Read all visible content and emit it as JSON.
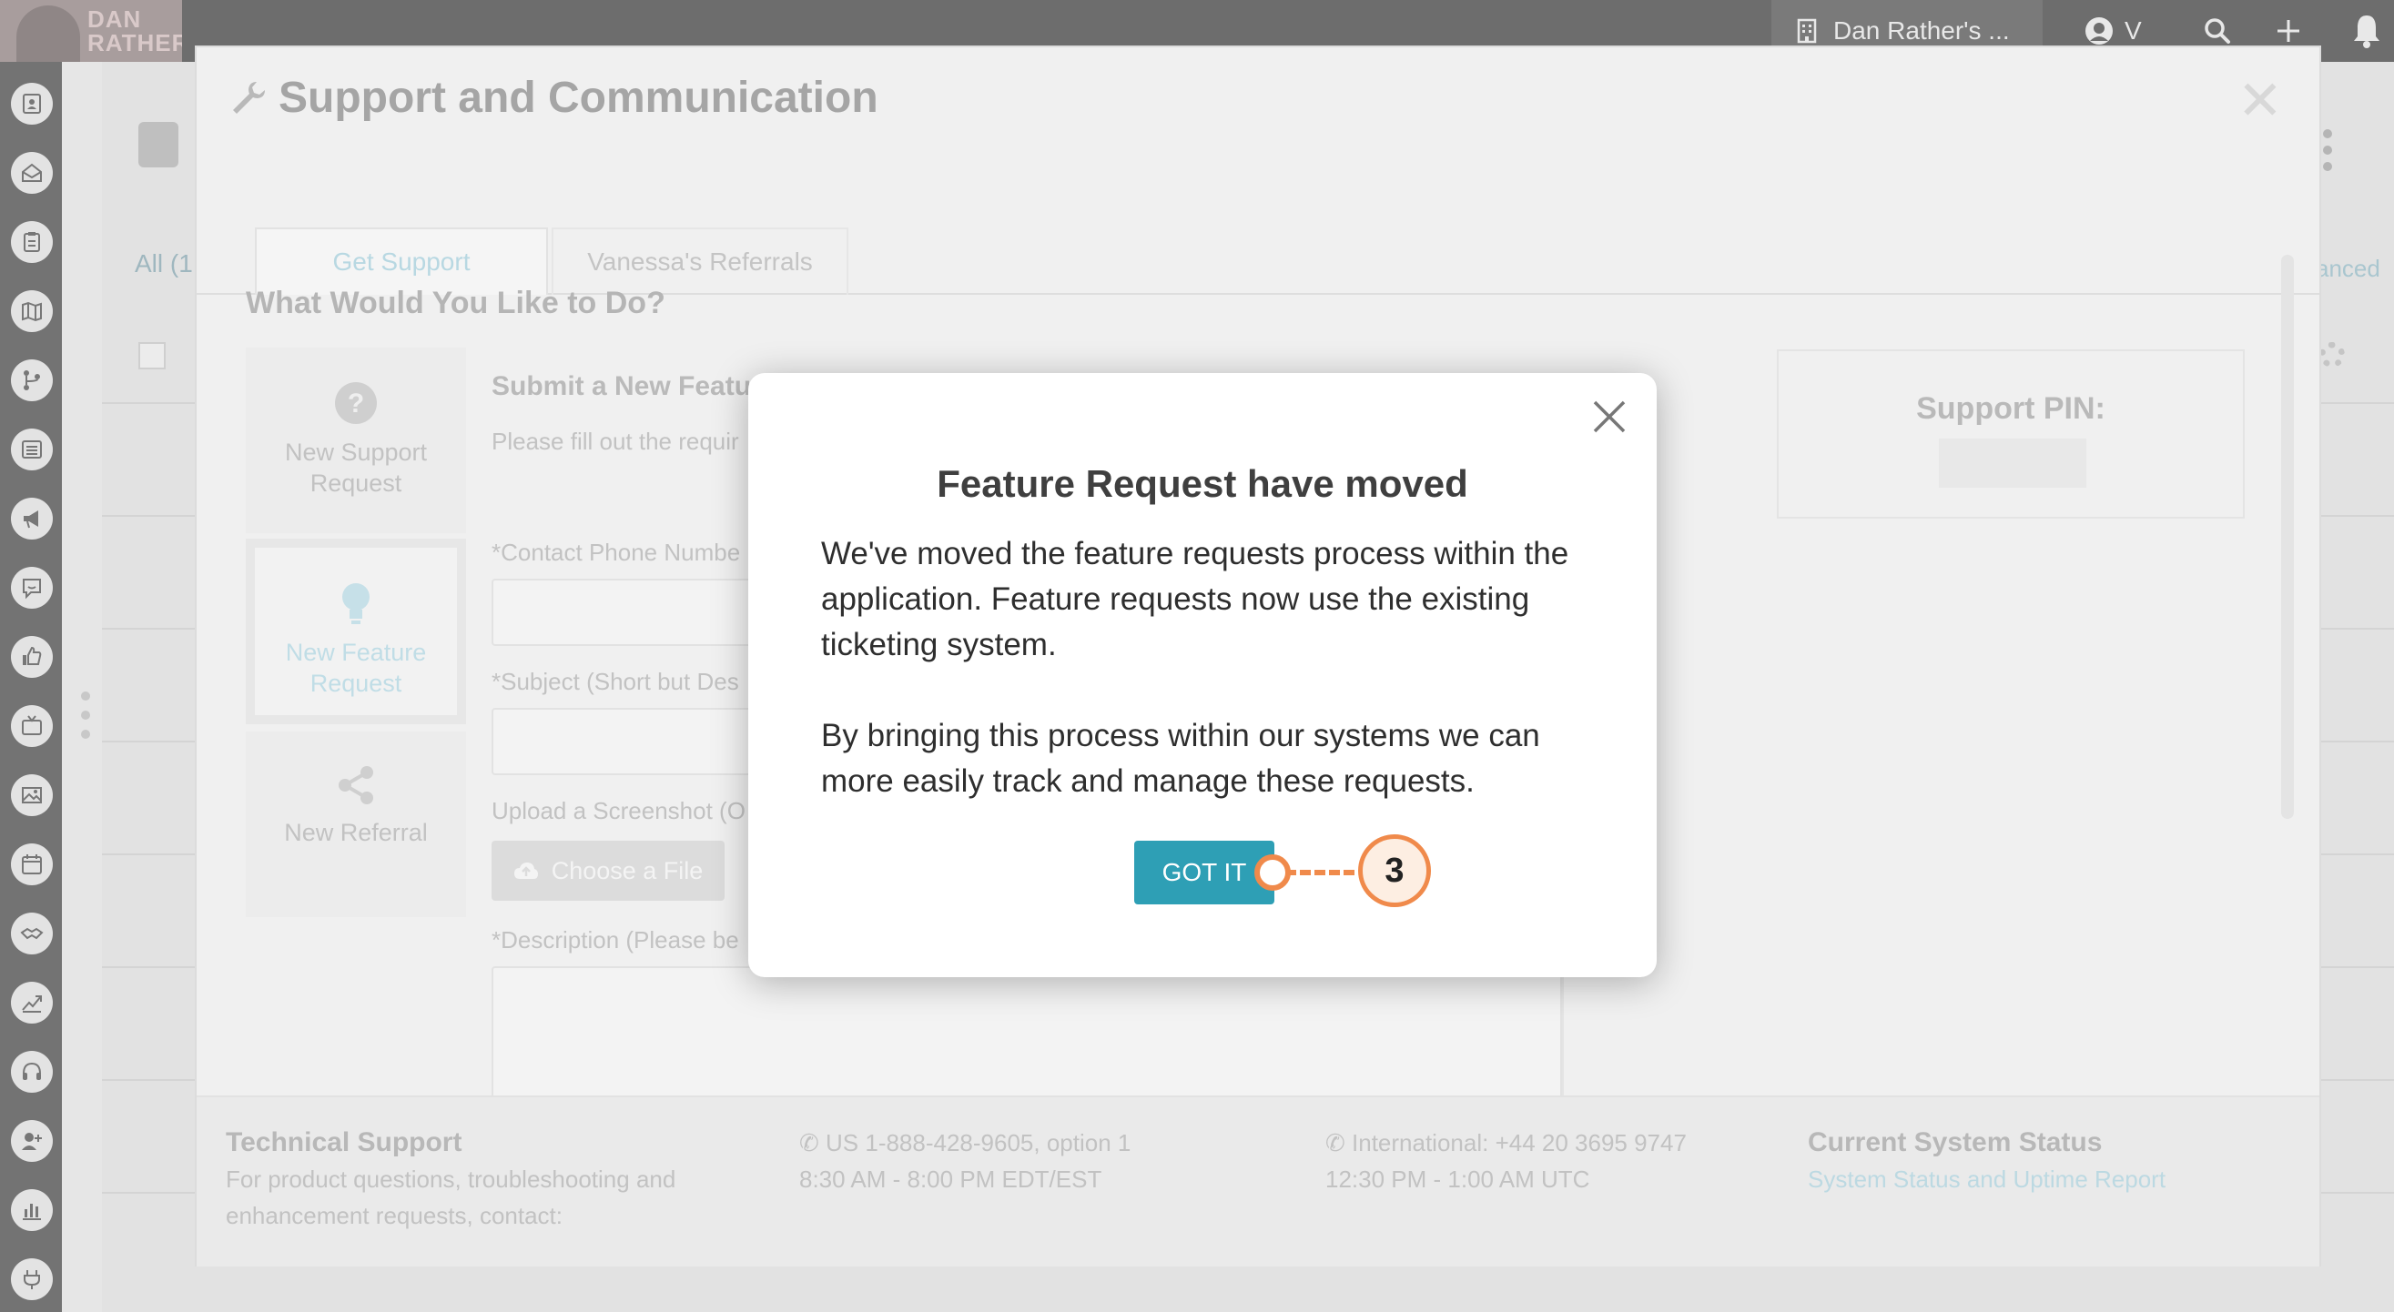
{
  "topbar": {
    "logo_text_1": "DAN",
    "logo_text_2": "RATHER",
    "company_label": "Dan Rather's ...",
    "user_initial": "V"
  },
  "sidebar": {
    "items": [
      "contacts-icon",
      "inbox-icon",
      "clipboard-icon",
      "map-icon",
      "workflow-icon",
      "list-icon",
      "megaphone-icon",
      "chat-icon",
      "thumbs-up-icon",
      "tv-icon",
      "image-icon",
      "calendar-icon",
      "handshake-icon",
      "trending-icon",
      "headset-icon",
      "add-user-icon",
      "bar-chart-icon",
      "plug-icon"
    ]
  },
  "support_modal": {
    "title": "Support and Communication",
    "tabs": [
      "Get Support",
      "Vanessa's Referrals"
    ],
    "question": "What Would You Like to Do?",
    "options": [
      "New Support Request",
      "New Feature Request",
      "New Referral"
    ],
    "form_heading": "Submit a New Featu",
    "form_intro": "Please fill out the requir",
    "phone_label": "*Contact Phone Numbe",
    "subject_label": "*Subject (Short but Des",
    "upload_label": "Upload a Screenshot (O",
    "choose_file": "Choose a File",
    "description_label": "*Description (Please be",
    "pin_label": "Support PIN:",
    "footer": {
      "tech_heading": "Technical Support",
      "tech_text": "For product questions, troubleshooting and enhancement requests, contact:",
      "us_phone": "US 1-888-428-9605, option 1",
      "us_hours": "8:30 AM - 8:00 PM EDT/EST",
      "intl_phone": "International: +44 20 3695 9747",
      "intl_hours": "12:30 PM - 1:00 AM UTC",
      "status_heading": "Current System Status",
      "status_link": "System Status and Uptime Report"
    }
  },
  "background": {
    "all_label": "All (1",
    "advanced_label": "anced"
  },
  "dialog": {
    "title": "Feature Request have moved",
    "paragraph_1": "We've moved the feature requests process within the application. Feature requests now use the existing ticketing system.",
    "paragraph_2": "By bringing this process within our systems we can more easily track and manage these requests.",
    "button": "GOT IT",
    "step_number": "3"
  },
  "colors": {
    "accent": "#2e9fb5",
    "marker": "#f08a4b"
  }
}
